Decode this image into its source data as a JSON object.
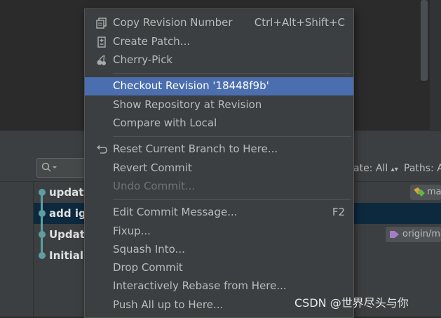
{
  "menu": {
    "items": [
      {
        "label": "Copy Revision Number",
        "shortcut": "Ctrl+Alt+Shift+C",
        "icon": "copy-icon"
      },
      {
        "label": "Create Patch...",
        "icon": "patch-icon"
      },
      {
        "label": "Cherry-Pick",
        "icon": "cherry-icon"
      },
      {
        "label": "Checkout Revision '18448f9b'",
        "selected": true
      },
      {
        "label": "Show Repository at Revision"
      },
      {
        "label": "Compare with Local"
      },
      {
        "label": "Reset Current Branch to Here...",
        "icon": "reset-icon"
      },
      {
        "label": "Revert Commit"
      },
      {
        "label": "Undo Commit...",
        "disabled": true
      },
      {
        "label": "Edit Commit Message...",
        "shortcut": "F2"
      },
      {
        "label": "Fixup..."
      },
      {
        "label": "Squash Into..."
      },
      {
        "label": "Drop Commit"
      },
      {
        "label": "Interactively Rebase from Here..."
      },
      {
        "label": "Push All up to Here..."
      }
    ]
  },
  "log": {
    "filters": {
      "date": "ate: All",
      "paths": "Paths: A"
    },
    "commits": [
      {
        "text": "update"
      },
      {
        "text": "add igr"
      },
      {
        "text": "Update"
      },
      {
        "text": "Initial c"
      }
    ],
    "tags": {
      "row1": "ma",
      "row3": "origin/ma"
    }
  },
  "colors": {
    "accent": "#4b6eaf",
    "selected_row": "#0d293e",
    "graph": "#5f9ea0",
    "tag_green": "#62b543",
    "tag_yellow": "#d9a343",
    "tag_purple": "#a57cc7"
  },
  "watermark": "CSDN @世界尽头与你"
}
